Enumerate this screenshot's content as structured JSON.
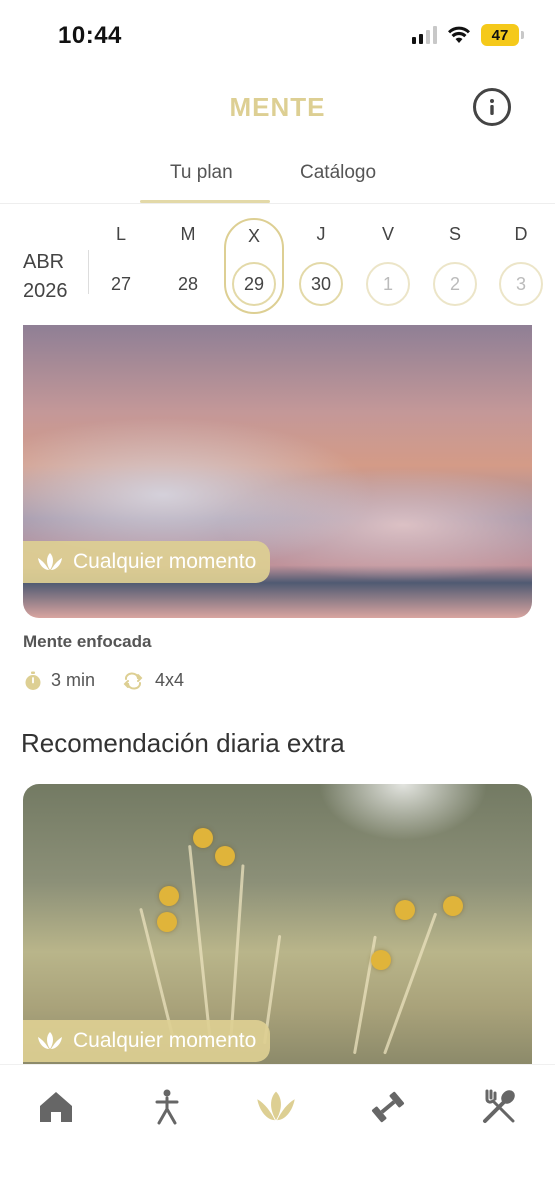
{
  "status_bar": {
    "time": "10:44",
    "battery": "47"
  },
  "header": {
    "title": "MENTE"
  },
  "tabs": [
    {
      "label": "Tu plan",
      "active": true
    },
    {
      "label": "Catálogo",
      "active": false
    }
  ],
  "calendar": {
    "month": "ABR",
    "year": "2026",
    "days": [
      {
        "letter": "L",
        "number": "27",
        "state": "past"
      },
      {
        "letter": "M",
        "number": "28",
        "state": "past"
      },
      {
        "letter": "X",
        "number": "29",
        "state": "today"
      },
      {
        "letter": "J",
        "number": "30",
        "state": "ring"
      },
      {
        "letter": "V",
        "number": "1",
        "state": "future"
      },
      {
        "letter": "S",
        "number": "2",
        "state": "future"
      },
      {
        "letter": "D",
        "number": "3",
        "state": "future"
      }
    ]
  },
  "main_card": {
    "badge": "Cualquier momento",
    "title": "Mente enfocada",
    "duration": "3 min",
    "pattern": "4x4"
  },
  "extra_section": {
    "title": "Recomendación diaria extra",
    "badge": "Cualquier momento"
  },
  "colors": {
    "gold": "#ddcf93",
    "gold_light": "#e3d9a8"
  },
  "bottom_nav": [
    {
      "icon": "home-icon",
      "active": false
    },
    {
      "icon": "stretch-person-icon",
      "active": false
    },
    {
      "icon": "lotus-icon",
      "active": true
    },
    {
      "icon": "dumbbell-icon",
      "active": false
    },
    {
      "icon": "fork-spoon-icon",
      "active": false
    }
  ]
}
